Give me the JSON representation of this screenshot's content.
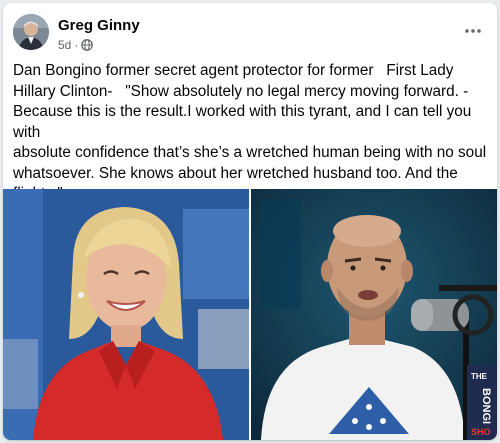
{
  "post": {
    "author": "Greg Ginny",
    "time": "5d",
    "separator": "·",
    "privacy_icon": "globe-icon",
    "menu_icon": "more-options-icon",
    "text": "Dan Bongino former secret agent protector for former   First Lady\nHillary Clinton-   \"Show absolutely no legal mercy moving forward. -\nBecause this is the result.I worked with this tyrant, and I can tell you with\nabsolute confidence that’s she’s a wretched human being with no soul\nwhatsoever. She knows about her wretched husband too. And the\nflights.\""
  },
  "photos": {
    "left": {
      "subject": "smiling-woman-red-jacket-photo"
    },
    "right": {
      "subject": "man-at-microphone-photo",
      "sign_text": [
        "THE",
        "BONGI",
        "SHO"
      ]
    }
  },
  "colors": {
    "text": "#050505",
    "secondary_text": "#65676b",
    "left_background": "#2b5a9c",
    "right_background": "#12354f",
    "red_jacket": "#d42a2a"
  }
}
